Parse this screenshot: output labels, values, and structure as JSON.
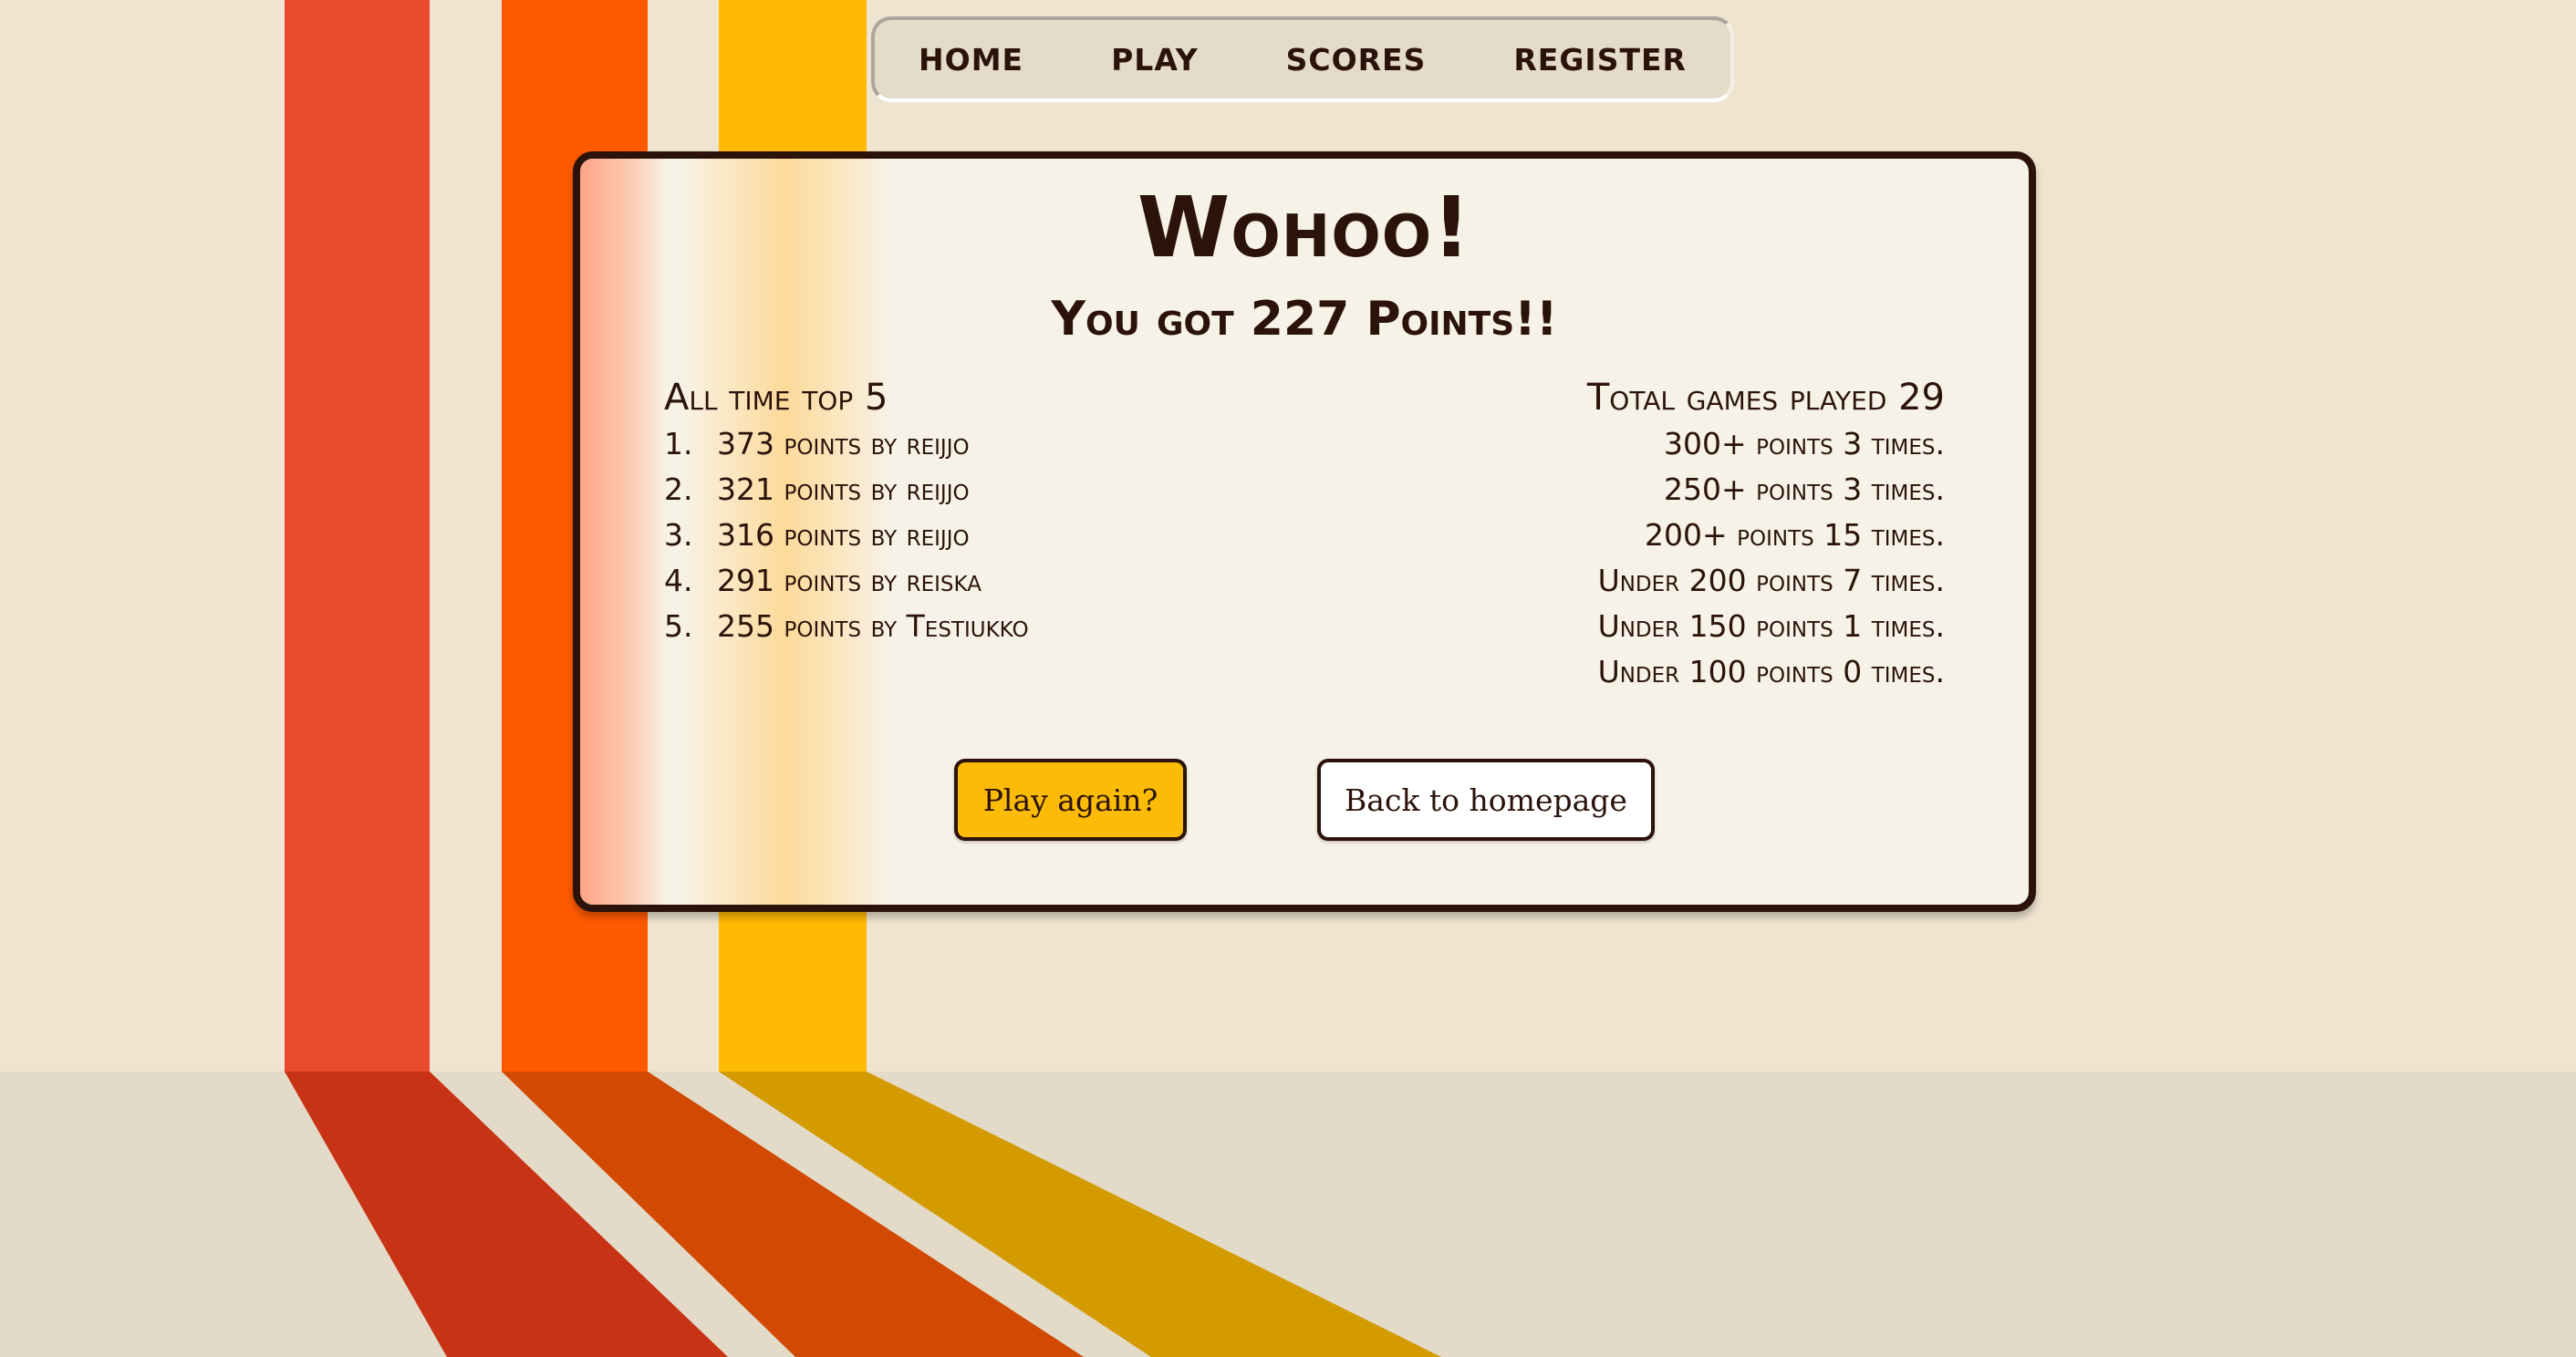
{
  "nav": {
    "items": [
      "HOME",
      "PLAY",
      "SCORES",
      "REGISTER"
    ]
  },
  "result": {
    "title": "Wohoo!",
    "subtitle": "You got 227 Points!!"
  },
  "top_scores": {
    "heading": "All time top 5",
    "entries": [
      {
        "rank": "1.",
        "text": "373 points by reijjo"
      },
      {
        "rank": "2.",
        "text": "321 points by reijjo"
      },
      {
        "rank": "3.",
        "text": "316 points by reijjo"
      },
      {
        "rank": "4.",
        "text": "291 points by reiska"
      },
      {
        "rank": "5.",
        "text": "255 points by Testiukko"
      }
    ]
  },
  "stats": {
    "heading": "Total games played 29",
    "rows": [
      "300+ points 3 times.",
      "250+ points 3 times.",
      "200+ points 15 times.",
      "Under 200 points 7 times.",
      "Under 150 points 1 times.",
      "Under 100 points 0 times."
    ]
  },
  "buttons": {
    "play_again": "Play again?",
    "back_home": "Back to homepage"
  },
  "colors": {
    "background": "#efe4cf",
    "floor": "#e3dac8",
    "stripe_red": "#e84a2e",
    "stripe_orange": "#ff5a00",
    "stripe_yellow": "#ffba04",
    "shadow_red": "#c83215",
    "shadow_orange": "#d24a02",
    "shadow_yellow": "#d39b00",
    "text_dark": "#2b130b",
    "play_button": "#fbbb06"
  }
}
